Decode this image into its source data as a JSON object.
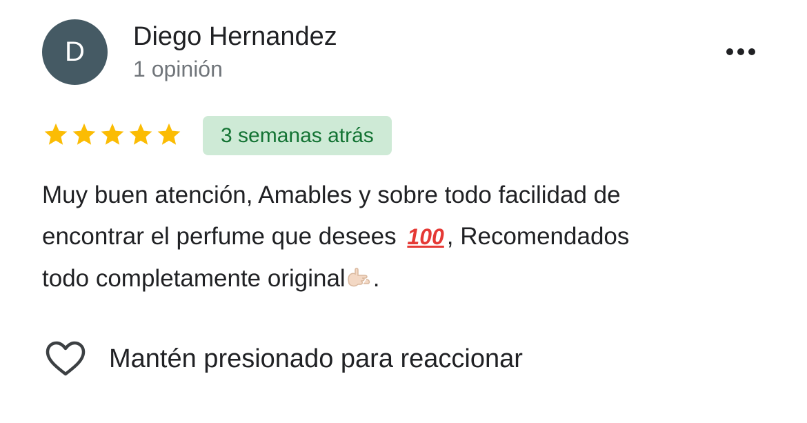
{
  "review": {
    "author": {
      "initial": "D",
      "name": "Diego Hernandez",
      "review_count": "1 opinión",
      "avatar_color": "#455a64"
    },
    "more_options_icon": "more-horizontal-icon",
    "rating": {
      "value": 5,
      "max": 5,
      "star_color": "#fbbc04"
    },
    "time_ago": "3 semanas atrás",
    "text": {
      "line1": "Muy buen atención, Amables y sobre todo facilidad de",
      "line2_start": "encontrar el perfume que desees",
      "emoji_hundred": "💯",
      "line2_end": ", Recomendados",
      "line3_start": "todo completamente original",
      "emoji_hand": "🤙🏻",
      "line3_end": "."
    },
    "reaction": {
      "icon": "heart-outline-icon",
      "label": "Mantén presionado para reaccionar"
    }
  }
}
